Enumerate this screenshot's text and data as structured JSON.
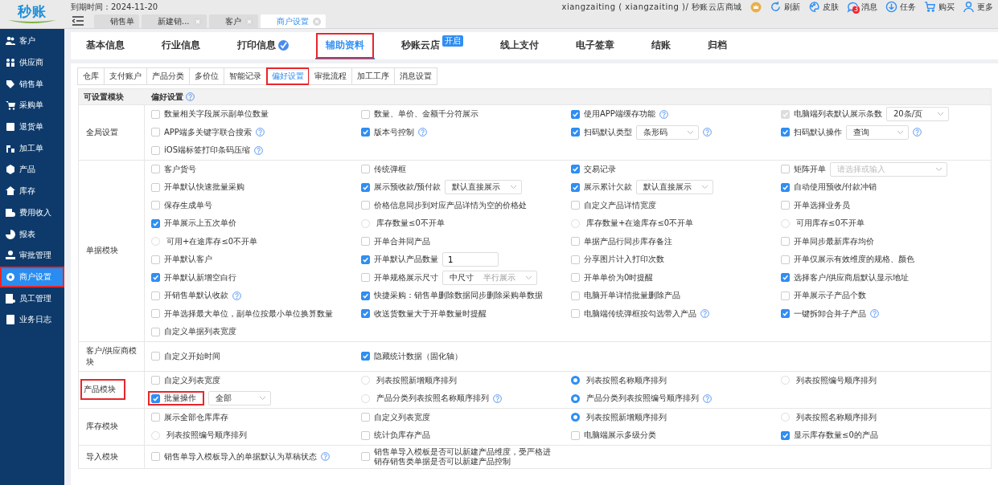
{
  "logo": "秒账",
  "expiry": "到期时间：2024-11-20",
  "page_tabs": [
    {
      "label": "销售单",
      "selected": false,
      "closable": false
    },
    {
      "label": "新建销...",
      "selected": false,
      "closable": true
    },
    {
      "label": "客户",
      "selected": false,
      "closable": true
    },
    {
      "label": "商户设置",
      "selected": true,
      "closable": true
    }
  ],
  "user": "xiangzaiting ( xiangzaiting )/ 秒账云店商城",
  "toolbar": [
    {
      "label": "刷新"
    },
    {
      "label": "皮肤"
    },
    {
      "label": "消息",
      "badge": "3"
    },
    {
      "label": "任务"
    },
    {
      "label": "购买"
    },
    {
      "label": "更多"
    }
  ],
  "sidebar": [
    {
      "label": "客户",
      "selected": false,
      "highlighted": false
    },
    {
      "label": "供应商",
      "selected": false,
      "highlighted": false
    },
    {
      "label": "销售单",
      "selected": false,
      "highlighted": false
    },
    {
      "label": "采购单",
      "selected": false,
      "highlighted": false
    },
    {
      "label": "退货单",
      "selected": false,
      "highlighted": false
    },
    {
      "label": "加工单",
      "selected": false,
      "highlighted": false
    },
    {
      "label": "产品",
      "selected": false,
      "highlighted": false
    },
    {
      "label": "库存",
      "selected": false,
      "highlighted": false
    },
    {
      "label": "费用收入",
      "selected": false,
      "highlighted": false
    },
    {
      "label": "报表",
      "selected": false,
      "highlighted": false
    },
    {
      "label": "审批管理",
      "selected": false,
      "highlighted": false
    },
    {
      "label": "商户设置",
      "selected": true,
      "highlighted": true
    },
    {
      "label": "员工管理",
      "selected": false,
      "highlighted": false
    },
    {
      "label": "业务日志",
      "selected": false,
      "highlighted": false
    }
  ],
  "tabs": [
    {
      "label": "基本信息",
      "selected": false,
      "highlighted": false
    },
    {
      "label": "行业信息",
      "selected": false,
      "highlighted": false
    },
    {
      "label": "打印信息",
      "selected": false,
      "highlighted": false,
      "verified": true
    },
    {
      "label": "辅助资料",
      "selected": true,
      "highlighted": true
    },
    {
      "label": "秒账云店",
      "selected": false,
      "highlighted": false,
      "badge": "开启"
    },
    {
      "label": "线上支付",
      "selected": false,
      "highlighted": false
    },
    {
      "label": "电子签章",
      "selected": false,
      "highlighted": false
    },
    {
      "label": "结账",
      "selected": false,
      "highlighted": false
    },
    {
      "label": "归档",
      "selected": false,
      "highlighted": false
    }
  ],
  "subtabs": [
    {
      "label": "仓库",
      "selected": false,
      "highlighted": false
    },
    {
      "label": "支付账户",
      "selected": false,
      "highlighted": false
    },
    {
      "label": "产品分类",
      "selected": false,
      "highlighted": false
    },
    {
      "label": "多价位",
      "selected": false,
      "highlighted": false
    },
    {
      "label": "智能记录",
      "selected": false,
      "highlighted": false
    },
    {
      "label": "偏好设置",
      "selected": true,
      "highlighted": true
    },
    {
      "label": "审批流程",
      "selected": false,
      "highlighted": false
    },
    {
      "label": "加工工序",
      "selected": false,
      "highlighted": false
    },
    {
      "label": "消息设置",
      "selected": false,
      "highlighted": false
    }
  ],
  "table": {
    "columns": [
      "可设置模块",
      "偏好设置"
    ],
    "header_help": true,
    "modules": [
      {
        "name": "全局设置",
        "highlighted": false,
        "options": [
          {
            "kind": "checkbox",
            "label": "数量相关字段展示副单位数量",
            "checked": false
          },
          {
            "kind": "checkbox",
            "label": "数量、单价、金额千分符展示",
            "checked": false
          },
          {
            "kind": "checkbox",
            "label": "使用APP端缓存功能",
            "checked": true,
            "help": true
          },
          {
            "kind": "checkbox",
            "label": "电脑端列表默认展示条数",
            "checked": true,
            "disabled": true,
            "select": {
              "value": "20条/页"
            }
          },
          {
            "kind": "checkbox",
            "label": "APP端多关键字联合搜索",
            "checked": false,
            "help": true
          },
          {
            "kind": "checkbox",
            "label": "版本号控制",
            "checked": true,
            "help": true
          },
          {
            "kind": "checkbox",
            "label": "扫码默认类型",
            "checked": true,
            "select": {
              "value": "条形码"
            },
            "help": true
          },
          {
            "kind": "checkbox",
            "label": "扫码默认操作",
            "checked": true,
            "select": {
              "value": "查询"
            },
            "help": true
          },
          {
            "kind": "checkbox",
            "label": "iOS端标签打印条码压缩",
            "checked": false,
            "help": true
          }
        ]
      },
      {
        "name": "单据模块",
        "highlighted": false,
        "options": [
          {
            "kind": "checkbox",
            "label": "客户货号",
            "checked": false
          },
          {
            "kind": "checkbox",
            "label": "传统弹框",
            "checked": false
          },
          {
            "kind": "checkbox",
            "label": "交易记录",
            "checked": true
          },
          {
            "kind": "checkbox",
            "label": "矩阵开单",
            "checked": false,
            "select": {
              "placeholder": "请选择或输入"
            }
          },
          {
            "kind": "checkbox",
            "label": "开单默认快速批量采购",
            "checked": false
          },
          {
            "kind": "checkbox",
            "label": "展示预收款/预付款",
            "checked": true,
            "select": {
              "value": "默认直接展示"
            }
          },
          {
            "kind": "checkbox",
            "label": "展示累计欠款",
            "checked": true,
            "select": {
              "value": "默认直接展示"
            }
          },
          {
            "kind": "checkbox",
            "label": "自动使用预收/付款冲销",
            "checked": true
          },
          {
            "kind": "checkbox",
            "label": "保存生成单号",
            "checked": false
          },
          {
            "kind": "checkbox",
            "label": "价格信息同步到对应产品详情为空的价格处",
            "checked": false
          },
          {
            "kind": "checkbox",
            "label": "自定义产品详情宽度",
            "checked": false
          },
          {
            "kind": "checkbox",
            "label": "开单选择业务员",
            "checked": false
          },
          {
            "kind": "checkbox",
            "label": "开单展示上五次单价",
            "checked": true
          },
          {
            "kind": "radio",
            "label": "库存数量≤0不开单",
            "checked": false
          },
          {
            "kind": "radio",
            "label": "库存数量+在途库存≤0不开单",
            "checked": false
          },
          {
            "kind": "radio",
            "label": "可用库存≤0不开单",
            "checked": false
          },
          {
            "kind": "radio",
            "label": "可用+在途库存≤0不开单",
            "checked": false
          },
          {
            "kind": "checkbox",
            "label": "开单合并同产品",
            "checked": false
          },
          {
            "kind": "checkbox",
            "label": "单据产品行同步库存备注",
            "checked": false
          },
          {
            "kind": "checkbox",
            "label": "开单同步最新库存均价",
            "checked": false
          },
          {
            "kind": "checkbox",
            "label": "开单默认客户",
            "checked": false
          },
          {
            "kind": "checkbox",
            "label": "开单默认产品数量",
            "checked": true,
            "input": "1"
          },
          {
            "kind": "checkbox",
            "label": "分享图片计入打印次数",
            "checked": false
          },
          {
            "kind": "checkbox",
            "label": "开单仅展示有效维度的规格、颜色",
            "checked": false
          },
          {
            "kind": "checkbox",
            "label": "开单默认新增空白行",
            "checked": true
          },
          {
            "kind": "checkbox",
            "label": "开单规格展示尺寸",
            "checked": false,
            "select": {
              "value": "中尺寸",
              "extra": "半行展示"
            }
          },
          {
            "kind": "checkbox",
            "label": "开单单价为0时提醒",
            "checked": false
          },
          {
            "kind": "checkbox",
            "label": "选择客户/供应商后默认显示地址",
            "checked": true
          },
          {
            "kind": "checkbox",
            "label": "开销售单默认收款",
            "checked": false,
            "help": true
          },
          {
            "kind": "checkbox",
            "label": "快捷采购：销售单删除数据同步删除采购单数据",
            "checked": true
          },
          {
            "kind": "checkbox",
            "label": "电脑开单详情批量删除产品",
            "checked": false
          },
          {
            "kind": "checkbox",
            "label": "开单展示子产品个数",
            "checked": false
          },
          {
            "kind": "checkbox",
            "label": "开单选择最大单位，副单位按最小单位换算数量",
            "checked": false
          },
          {
            "kind": "checkbox",
            "label": "收送货数量大于开单数量时提醒",
            "checked": true
          },
          {
            "kind": "checkbox",
            "label": "电脑端传统弹框按勾选带入产品",
            "checked": false,
            "help": true
          },
          {
            "kind": "checkbox",
            "label": "一键拆卸合并子产品",
            "checked": true,
            "help": true
          },
          {
            "kind": "checkbox",
            "label": "自定义单据列表宽度",
            "checked": false
          }
        ]
      },
      {
        "name": "客户/供应商模块",
        "highlighted": false,
        "options": [
          {
            "kind": "checkbox",
            "label": "自定义开始时间",
            "checked": false
          },
          {
            "kind": "checkbox",
            "label": "隐藏统计数据（固化轴）",
            "checked": true
          }
        ]
      },
      {
        "name": "产品模块",
        "highlighted": true,
        "options": [
          {
            "kind": "checkbox",
            "label": "自定义列表宽度",
            "checked": false
          },
          {
            "kind": "radio",
            "label": "列表按照新增顺序排列",
            "checked": false
          },
          {
            "kind": "radio",
            "label": "列表按照名称顺序排列",
            "checked": true
          },
          {
            "kind": "radio",
            "label": "列表按照编号顺序排列",
            "checked": false
          },
          {
            "kind": "checkbox",
            "label": "批量操作",
            "checked": true,
            "highlighted": true,
            "select": {
              "value": "全部"
            }
          },
          {
            "kind": "radio",
            "label": "产品分类列表按照名称顺序排列",
            "checked": false,
            "help": true
          },
          {
            "kind": "radio",
            "label": "产品分类列表按照编号顺序排列",
            "checked": true,
            "help": true
          }
        ]
      },
      {
        "name": "库存模块",
        "highlighted": false,
        "options": [
          {
            "kind": "checkbox",
            "label": "展示全部仓库库存",
            "checked": false
          },
          {
            "kind": "checkbox",
            "label": "自定义列表宽度",
            "checked": false
          },
          {
            "kind": "radio",
            "label": "列表按照新增顺序排列",
            "checked": true
          },
          {
            "kind": "radio",
            "label": "列表按照名称顺序排列",
            "checked": false
          },
          {
            "kind": "radio",
            "label": "列表按照编号顺序排列",
            "checked": false
          },
          {
            "kind": "checkbox",
            "label": "统计负库存产品",
            "checked": false
          },
          {
            "kind": "checkbox",
            "label": "电脑端展示多级分类",
            "checked": false
          },
          {
            "kind": "checkbox",
            "label": "显示库存数量≤0的产品",
            "checked": true
          }
        ]
      },
      {
        "name": "导入模块",
        "highlighted": false,
        "options": [
          {
            "kind": "checkbox",
            "label": "销售单导入模板导入的单据默认为草稿状态",
            "checked": false,
            "help": true
          },
          {
            "kind": "checkbox",
            "label": "销售单导入模板是否可以新建产品维度，受严格进销存销售类单据是否可以新建产品控制",
            "checked": false
          }
        ]
      }
    ]
  }
}
